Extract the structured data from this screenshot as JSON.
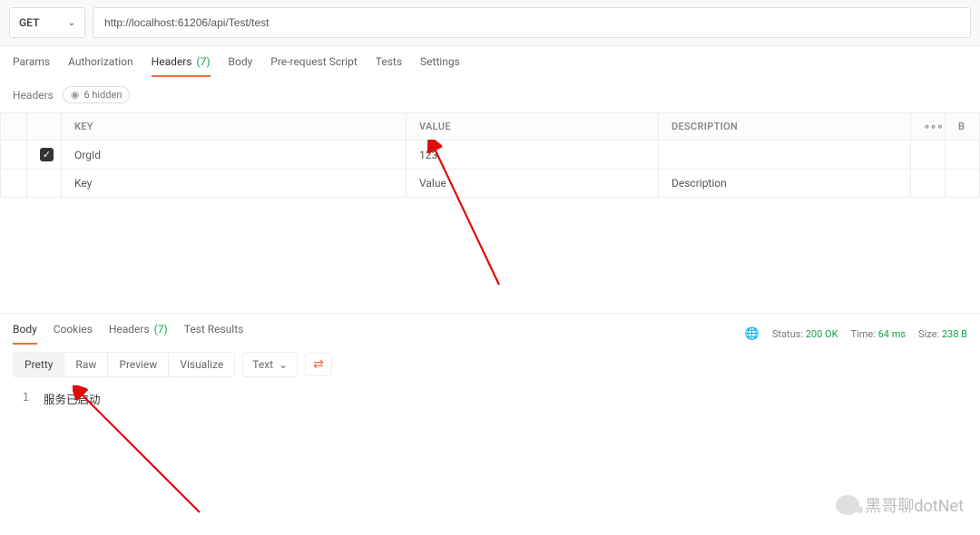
{
  "request": {
    "method": "GET",
    "url": "http://localhost:61206/api/Test/test"
  },
  "request_tabs": {
    "params": "Params",
    "authorization": "Authorization",
    "headers_label": "Headers",
    "headers_count": "(7)",
    "body": "Body",
    "prerequest": "Pre-request Script",
    "tests": "Tests",
    "settings": "Settings"
  },
  "headers_section": {
    "title": "Headers",
    "hidden_pill": "6 hidden"
  },
  "headers_table": {
    "columns": {
      "key": "KEY",
      "value": "VALUE",
      "description": "DESCRIPTION",
      "more": "∘∘∘",
      "bulk": "B"
    },
    "rows": [
      {
        "enabled": true,
        "key": "OrgId",
        "value": "123",
        "description": ""
      }
    ],
    "placeholder": {
      "key": "Key",
      "value": "Value",
      "description": "Description"
    }
  },
  "response_tabs": {
    "body": "Body",
    "cookies": "Cookies",
    "headers_label": "Headers",
    "headers_count": "(7)",
    "test_results": "Test Results"
  },
  "response_meta": {
    "status_label": "Status:",
    "status_value": "200 OK",
    "time_label": "Time:",
    "time_value": "64 ms",
    "size_label": "Size:",
    "size_value": "238 B"
  },
  "response_view": {
    "pretty": "Pretty",
    "raw": "Raw",
    "preview": "Preview",
    "visualize": "Visualize",
    "format": "Text"
  },
  "response_body": {
    "lines": [
      {
        "n": "1",
        "text": "服务已启动"
      }
    ]
  },
  "watermark": "黑哥聊dotNet"
}
